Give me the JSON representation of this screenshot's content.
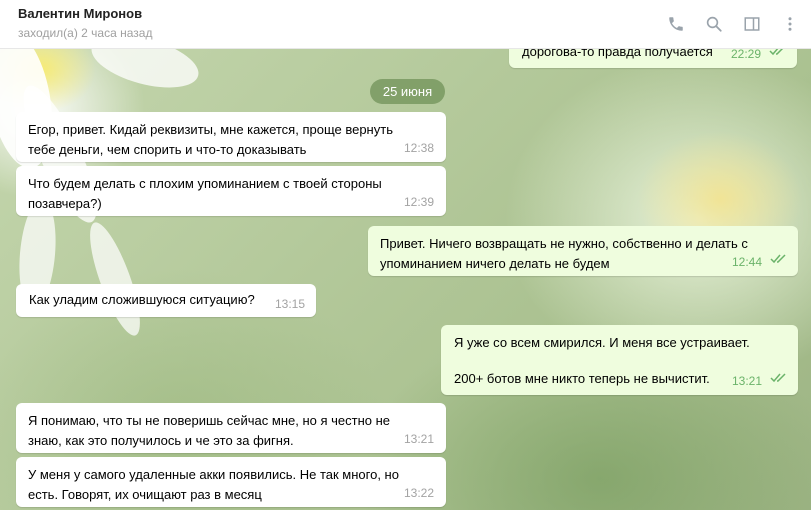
{
  "header": {
    "contact_name": "Валентин Миронов",
    "status": "заходил(а) 2 часа назад",
    "icons": [
      "phone-icon",
      "search-icon",
      "sidebar-toggle-icon",
      "more-icon"
    ]
  },
  "colors": {
    "incoming_bubble": "#ffffff",
    "outgoing_bubble": "#effdde",
    "outgoing_time": "#6bb36a",
    "date_pill": "#709258"
  },
  "chat": {
    "date_separator": "25 июня",
    "messages": [
      {
        "direction": "out",
        "text": "дорогова-то правда получается",
        "time": "22:29",
        "read": true
      },
      {
        "direction": "in",
        "text": "Егор, привет. Кидай реквизиты, мне кажется, проще вернуть тебе деньги, чем спорить и что-то доказывать",
        "time": "12:38"
      },
      {
        "direction": "in",
        "text": "Что будем делать с плохим упоминанием с твоей стороны позавчера?)",
        "time": "12:39"
      },
      {
        "direction": "out",
        "text": "Привет. Ничего возвращать не нужно, собственно и делать с упоминанием ничего делать не будем",
        "time": "12:44",
        "read": true
      },
      {
        "direction": "in",
        "text": "Как уладим сложившуюся ситуацию?",
        "time": "13:15"
      },
      {
        "direction": "out",
        "text_line1": "Я уже со всем смирился. И меня все устраивает.",
        "text_line2": "200+ ботов мне никто теперь не вычистит.",
        "time": "13:21",
        "read": true
      },
      {
        "direction": "in",
        "text": "Я понимаю, что ты не поверишь сейчас мне, но я честно не знаю, как это получилось и че это за фигня.",
        "time": "13:21"
      },
      {
        "direction": "in",
        "text": "У меня у самого удаленные акки появились. Не так много, но есть. Говорят, их очищают раз в месяц",
        "time": "13:22"
      }
    ]
  }
}
